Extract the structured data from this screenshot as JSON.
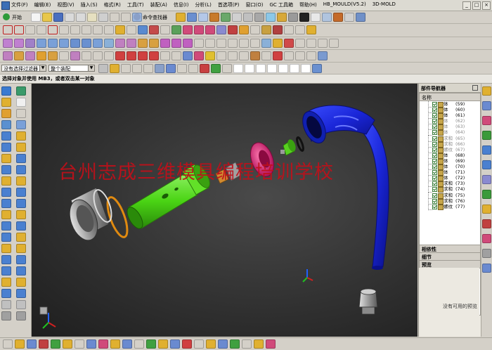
{
  "menu": {
    "items": [
      "文件(F)",
      "编辑(E)",
      "视图(V)",
      "插入(S)",
      "格式(R)",
      "工具(T)",
      "装配(A)",
      "信息(I)",
      "分析(L)",
      "首选项(P)",
      "窗口(O)",
      "GC 工具箱",
      "帮助(H)",
      "HB_MOULD(V5.2)",
      "3D-MOLD"
    ],
    "window_controls": [
      "_",
      "□",
      "×"
    ]
  },
  "toolbar": {
    "start_label": "开始",
    "command_finder_label": "命令查找器",
    "filter_value": "没有选择过滤器",
    "assembly_value": "整个装配"
  },
  "prompt": {
    "text": "选择对象并使用 MB3，或者双击某一对象"
  },
  "viewport": {
    "watermark": "台州志成三维模具编程培训学校",
    "background": "#2f2f2f",
    "part_colors": {
      "tube": "#1f2fd8",
      "magenta_ring": "#d8287a",
      "green_body": "#4ad414",
      "small_green": "#58d020",
      "orange": "#e08a10",
      "steel": "#b8b8b8"
    }
  },
  "part_navigator": {
    "title": "部件导航器",
    "column_header": "名称",
    "rows": [
      {
        "label": "体",
        "value": "(59)",
        "greyed": false
      },
      {
        "label": "体",
        "value": "(60)",
        "greyed": false
      },
      {
        "label": "体",
        "value": "(61)",
        "greyed": false
      },
      {
        "label": "体",
        "value": "(62)",
        "greyed": true
      },
      {
        "label": "体",
        "value": "(63)",
        "greyed": true
      },
      {
        "label": "体",
        "value": "(64)",
        "greyed": true
      },
      {
        "label": "求和",
        "value": "(65)",
        "greyed": true
      },
      {
        "label": "求和",
        "value": "(66)",
        "greyed": true
      },
      {
        "label": "螺纹",
        "value": "(67)",
        "greyed": true
      },
      {
        "label": "体",
        "value": "(68)",
        "greyed": false
      },
      {
        "label": "体",
        "value": "(69)",
        "greyed": false
      },
      {
        "label": "体",
        "value": "(70)",
        "greyed": false
      },
      {
        "label": "体",
        "value": "(71)",
        "greyed": false
      },
      {
        "label": "体",
        "value": "(72)",
        "greyed": false
      },
      {
        "label": "求和",
        "value": "(73)",
        "greyed": false
      },
      {
        "label": "求和",
        "value": "(74)",
        "greyed": false
      },
      {
        "label": "求和",
        "value": "(75)",
        "greyed": false
      },
      {
        "label": "求和",
        "value": "(76)",
        "greyed": false
      },
      {
        "label": "螺纹",
        "value": "(77)",
        "greyed": false
      }
    ],
    "sections": {
      "dependencies": "相依性",
      "details": "细节",
      "preview": "预览"
    },
    "preview_empty": "没有可用的预览"
  }
}
